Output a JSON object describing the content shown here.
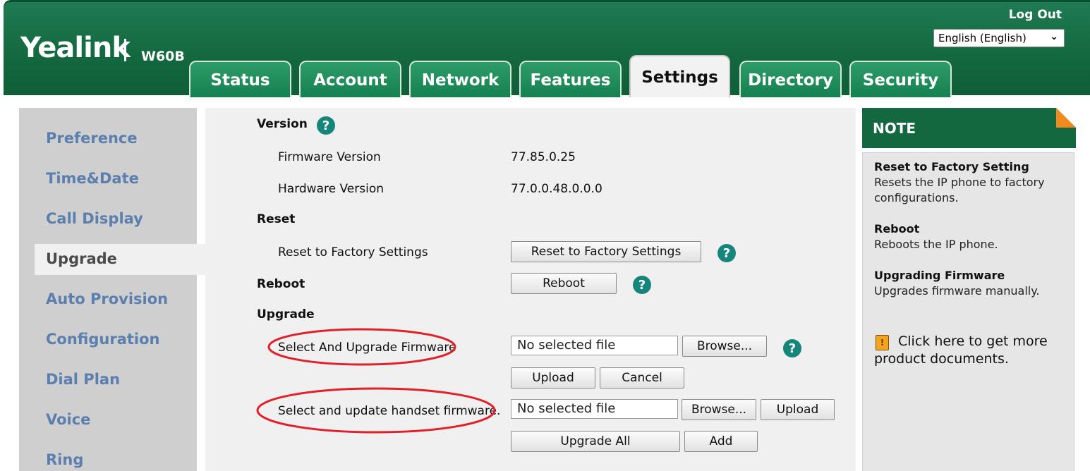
{
  "header": {
    "logo": "Yealink",
    "model": "W60B",
    "logout": "Log Out",
    "language": "English (English)"
  },
  "tabs": [
    {
      "label": "Status"
    },
    {
      "label": "Account"
    },
    {
      "label": "Network"
    },
    {
      "label": "Features"
    },
    {
      "label": "Settings",
      "active": true
    },
    {
      "label": "Directory"
    },
    {
      "label": "Security"
    }
  ],
  "sidebar": {
    "items": [
      {
        "label": "Preference"
      },
      {
        "label": "Time&Date"
      },
      {
        "label": "Call Display"
      },
      {
        "label": "Upgrade",
        "active": true
      },
      {
        "label": "Auto Provision"
      },
      {
        "label": "Configuration"
      },
      {
        "label": "Dial Plan"
      },
      {
        "label": "Voice"
      },
      {
        "label": "Ring"
      }
    ]
  },
  "main": {
    "version": {
      "title": "Version",
      "firmware_label": "Firmware Version",
      "firmware_value": "77.85.0.25",
      "hardware_label": "Hardware Version",
      "hardware_value": "77.0.0.48.0.0.0"
    },
    "reset": {
      "title": "Reset",
      "label": "Reset to Factory Settings",
      "button": "Reset to Factory Settings"
    },
    "reboot": {
      "title": "Reboot",
      "button": "Reboot"
    },
    "upgrade": {
      "title": "Upgrade",
      "firmware_label": "Select And Upgrade Firmware",
      "firmware_file": "No selected file",
      "browse": "Browse...",
      "upload": "Upload",
      "cancel": "Cancel",
      "handset_label": "Select and update handset firmware.",
      "handset_file": "No selected file",
      "handset_browse": "Browse...",
      "handset_upload": "Upload",
      "upgrade_all": "Upgrade All",
      "add": "Add"
    },
    "help_glyph": "?"
  },
  "note": {
    "title": "NOTE",
    "items": [
      {
        "term": "Reset to Factory Setting",
        "desc": "Resets the IP phone to factory configurations."
      },
      {
        "term": "Reboot",
        "desc": "Reboots the IP phone."
      },
      {
        "term": "Upgrading Firmware",
        "desc": "Upgrades firmware manually."
      }
    ],
    "doc_link": "Click here to get more product documents."
  },
  "colors": {
    "header_green": "#13683f",
    "sidebar_link": "#5b7fae",
    "help_teal": "#16867c",
    "note_corner": "#f08a1c",
    "annotation_red": "#e0202a"
  }
}
